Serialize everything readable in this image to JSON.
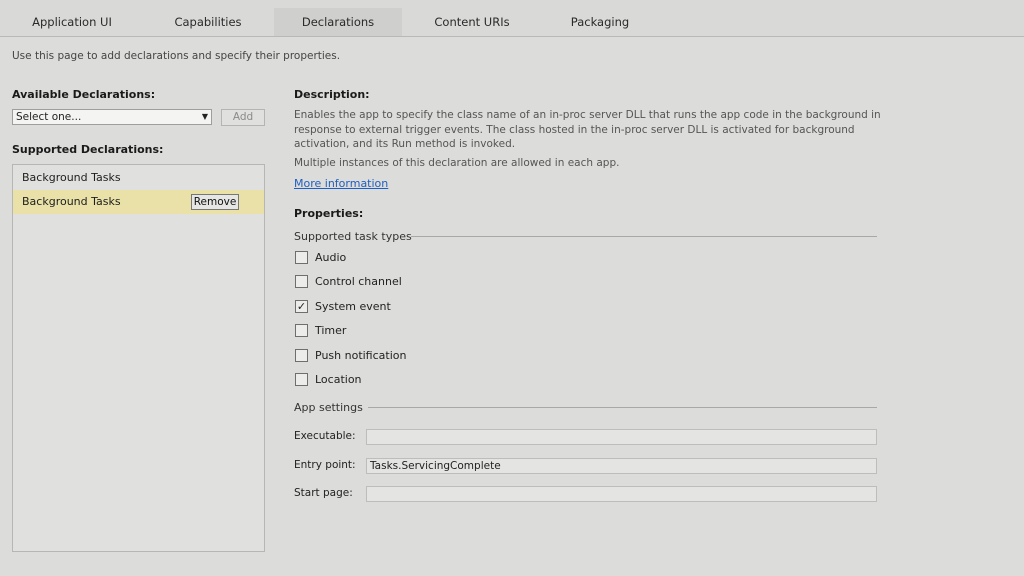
{
  "tabs": [
    {
      "label": "Application UI"
    },
    {
      "label": "Capabilities"
    },
    {
      "label": "Declarations"
    },
    {
      "label": "Content URIs"
    },
    {
      "label": "Packaging"
    }
  ],
  "intro_text": "Use this page to add declarations and specify their properties.",
  "available": {
    "title": "Available Declarations:",
    "select_value": "Select one...",
    "add_label": "Add"
  },
  "supported": {
    "title": "Supported Declarations:",
    "items": [
      {
        "label": "Background Tasks"
      },
      {
        "label": "Background Tasks",
        "remove_label": "Remove"
      }
    ]
  },
  "description": {
    "title": "Description:",
    "text": "Enables the app to specify the class name of an in-proc server DLL that runs the app code in the background in response to external trigger events. The class hosted in the in-proc server DLL is activated for background activation, and its Run method is invoked.",
    "multi_note": "Multiple instances of this declaration are allowed in each app.",
    "more_link": "More information"
  },
  "properties": {
    "title": "Properties:",
    "task_types_label": "Supported task types",
    "task_types": [
      {
        "label": "Audio",
        "checked": false
      },
      {
        "label": "Control channel",
        "checked": false
      },
      {
        "label": "System event",
        "checked": true
      },
      {
        "label": "Timer",
        "checked": false
      },
      {
        "label": "Push notification",
        "checked": false
      },
      {
        "label": "Location",
        "checked": false
      }
    ],
    "app_settings_label": "App settings",
    "fields": {
      "executable": {
        "label": "Executable:",
        "value": ""
      },
      "entry_point": {
        "label": "Entry point:",
        "value": "Tasks.ServicingComplete"
      },
      "start_page": {
        "label": "Start page:",
        "value": ""
      }
    }
  },
  "colors": {
    "background": "#dcdcda",
    "selected_row": "#e9e1a8",
    "link": "#1f5fc0"
  }
}
